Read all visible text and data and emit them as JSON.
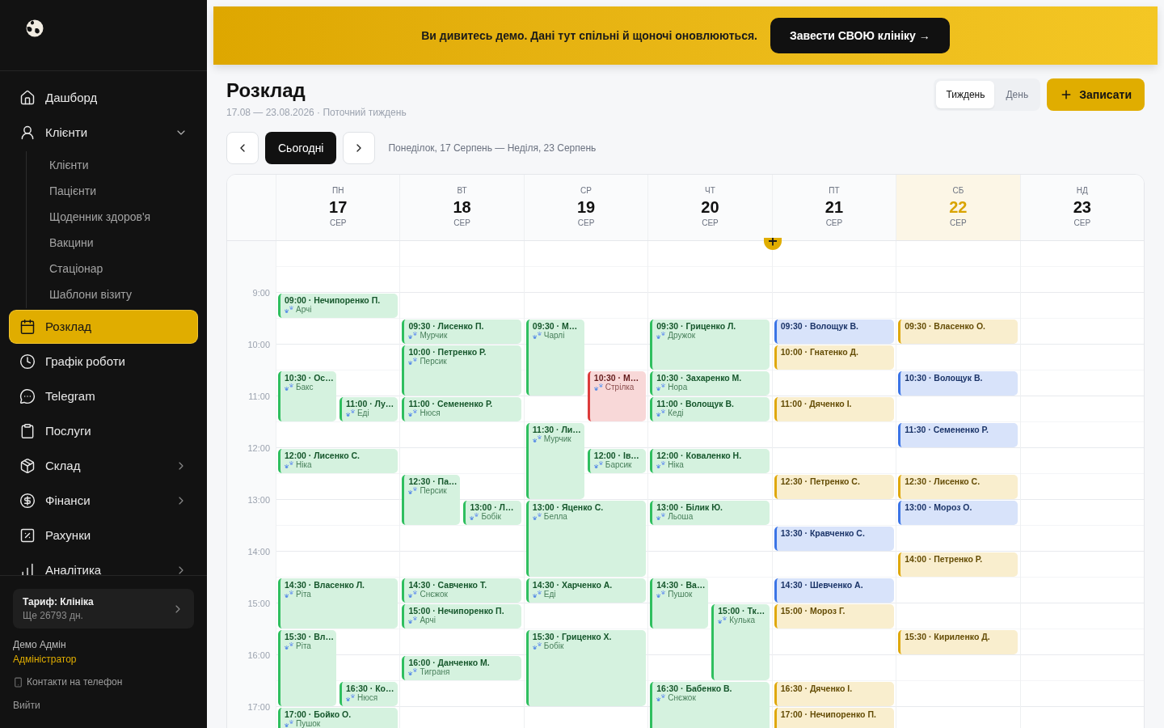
{
  "sidebar": {
    "nav": [
      {
        "label": "Дашборд",
        "selected": false
      },
      {
        "label": "Клієнти",
        "selected": false,
        "expanded": true,
        "children": [
          {
            "label": "Клієнти",
            "selected": false
          },
          {
            "label": "Пацієнти",
            "selected": false
          },
          {
            "label": "Щоденник здоров'я",
            "selected": false
          },
          {
            "label": "Вакцини",
            "selected": false
          },
          {
            "label": "Стаціонар",
            "selected": false
          },
          {
            "label": "Шаблони візиту",
            "selected": false
          }
        ]
      },
      {
        "label": "Розклад",
        "selected": true
      },
      {
        "label": "Графік роботи",
        "selected": false
      },
      {
        "label": "Telegram",
        "selected": false
      },
      {
        "label": "Послуги",
        "selected": false
      },
      {
        "label": "Склад",
        "selected": false,
        "expanded": false
      },
      {
        "label": "Фінанси",
        "selected": false,
        "expanded": false
      },
      {
        "label": "Рахунки",
        "selected": false
      },
      {
        "label": "Аналітика",
        "selected": false,
        "expanded": false
      }
    ],
    "plan": {
      "title": "Тариф: Клініка",
      "subtitle": "Ще 26793 дн."
    },
    "user": {
      "name": "Демо Адмін",
      "role": "Адміністратор"
    },
    "links": [
      {
        "label": "Контакти на телефон",
        "kind": "phone"
      },
      {
        "label": "Вийти",
        "kind": "plain"
      }
    ]
  },
  "banner": {
    "text": "Ви дивитесь демо. Дані тут спільні й щоночі оновлюються.",
    "button": "Завести СВОЮ клініку →"
  },
  "header": {
    "title": "Розклад",
    "subtitle": "17.08 — 23.08.2026 · Поточний тиждень",
    "views": [
      {
        "label": "Тиждень",
        "selected": true
      },
      {
        "label": "День",
        "selected": false
      }
    ],
    "add_button": "Записати"
  },
  "toolbar": {
    "today_button": "Сьогодні",
    "range": "Понеділок, 17 Серпень — Неділя, 23 Серпень"
  },
  "calendar": {
    "time_labels": [
      "9:00",
      "10:00",
      "11:00",
      "12:00",
      "13:00",
      "14:00",
      "15:00",
      "16:00",
      "17:00"
    ],
    "days": [
      {
        "weekday": "ПН",
        "date": "17",
        "month": "СЕР",
        "today": false,
        "events": [
          {
            "title": "09:00 · Нечипоренко П.",
            "pet": "Арчі",
            "kind": "short",
            "color": "#2fbf5f"
          },
          {
            "title": "10:30 · Ос…",
            "pet": "Бакс",
            "kind": "medium",
            "color": "#2fbf5f"
          },
          {
            "title": "11:00 · Лу…",
            "pet": "Еді",
            "kind": "short",
            "color": "#2fbf5f"
          },
          {
            "title": "12:00 · Лисенко С.",
            "pet": "Ніка",
            "kind": "short",
            "color": "#2fbf5f"
          },
          {
            "title": "14:30 · Власенко Л.",
            "pet": "Ріта",
            "kind": "medium",
            "color": "#2fbf5f"
          },
          {
            "title": "15:30 · Вл…",
            "pet": "Ріта",
            "kind": "long",
            "color": "#2fbf5f"
          },
          {
            "title": "16:30 · Ко…",
            "pet": "Нюся",
            "kind": "short",
            "color": "#2fbf5f"
          },
          {
            "title": "17:00 · Бойко О.",
            "pet": "Пушок",
            "kind": "short",
            "color": "#2fbf5f"
          }
        ]
      },
      {
        "weekday": "ВТ",
        "date": "18",
        "month": "СЕР",
        "today": false,
        "events": [
          {
            "title": "09:30 · Лисенко П.",
            "pet": "Мурчик",
            "kind": "short",
            "color": "#2fbf5f"
          },
          {
            "title": "10:00 · Петренко Р.",
            "pet": "Персик",
            "kind": "medium",
            "color": "#2fbf5f"
          },
          {
            "title": "11:00 · Семененко Р.",
            "pet": "Нюся",
            "kind": "short",
            "color": "#2fbf5f"
          },
          {
            "title": "12:30 · Па…",
            "pet": "Персик",
            "kind": "medium",
            "color": "#2fbf5f"
          },
          {
            "title": "13:00 · Л…",
            "pet": "Бобік",
            "kind": "short",
            "color": "#2fbf5f"
          },
          {
            "title": "14:30 · Савченко Т.",
            "pet": "Снєжок",
            "kind": "short",
            "color": "#2fbf5f"
          },
          {
            "title": "15:00 · Нечипоренко П.",
            "pet": "Арчі",
            "kind": "short",
            "color": "#2fbf5f"
          },
          {
            "title": "16:00 · Данченко М.",
            "pet": "Тиграня",
            "kind": "short",
            "color": "#2fbf5f"
          }
        ]
      },
      {
        "weekday": "СР",
        "date": "19",
        "month": "СЕР",
        "today": false,
        "events": [
          {
            "title": "09:30 · М…",
            "pet": "Чарлі",
            "kind": "long",
            "color": "#2fbf5f"
          },
          {
            "title": "10:30 · М…",
            "pet": "Стрілка",
            "kind": "medium",
            "color": "#dc3b3b"
          },
          {
            "title": "11:30 · Ли…",
            "pet": "Мурчик",
            "kind": "long",
            "color": "#2fbf5f"
          },
          {
            "title": "12:00 · Ів…",
            "pet": "Барсик",
            "kind": "short",
            "color": "#2fbf5f"
          },
          {
            "title": "13:00 · Яценко С.",
            "pet": "Белла",
            "kind": "long",
            "color": "#2fbf5f"
          },
          {
            "title": "14:30 · Харченко А.",
            "pet": "Еді",
            "kind": "short",
            "color": "#2fbf5f"
          },
          {
            "title": "15:30 · Гриценко Х.",
            "pet": "Бобік",
            "kind": "long",
            "color": "#2fbf5f"
          }
        ]
      },
      {
        "weekday": "ЧТ",
        "date": "20",
        "month": "СЕР",
        "today": false,
        "events": [
          {
            "title": "09:30 · Гриценко Л.",
            "pet": "Дружок",
            "kind": "medium",
            "color": "#2fbf5f"
          },
          {
            "title": "10:30 · Захаренко М.",
            "pet": "Нора",
            "kind": "short",
            "color": "#2fbf5f"
          },
          {
            "title": "11:00 · Волощук В.",
            "pet": "Кеді",
            "kind": "short",
            "color": "#2fbf5f"
          },
          {
            "title": "12:00 · Коваленко Н.",
            "pet": "Ніка",
            "kind": "short",
            "color": "#2fbf5f"
          },
          {
            "title": "13:00 · Білик Ю.",
            "pet": "Льоша",
            "kind": "short",
            "color": "#2fbf5f"
          },
          {
            "title": "14:30 · Ва…",
            "pet": "Пушок",
            "kind": "medium",
            "color": "#2fbf5f"
          },
          {
            "title": "15:00 · Тк…",
            "pet": "Кулька",
            "kind": "long",
            "color": "#2fbf5f"
          },
          {
            "title": "16:30 · Бабенко В.",
            "pet": "Снєжок",
            "kind": "medium",
            "color": "#2fbf5f"
          }
        ]
      },
      {
        "weekday": "ПТ",
        "date": "21",
        "month": "СЕР",
        "today": false,
        "events": [
          {
            "title": "09:30 · Волощук В.",
            "kind": "short",
            "color": "#3b74e6"
          },
          {
            "title": "10:00 · Гнатенко Д.",
            "kind": "short",
            "color": "#dfa80c"
          },
          {
            "title": "11:00 · Дяченко І.",
            "kind": "short",
            "color": "#dfa80c"
          },
          {
            "title": "12:30 · Петренко С.",
            "kind": "short",
            "color": "#dfa80c"
          },
          {
            "title": "13:30 · Кравченко С.",
            "kind": "short",
            "color": "#3b74e6"
          },
          {
            "title": "14:30 · Шевченко А.",
            "kind": "short",
            "color": "#3b74e6"
          },
          {
            "title": "15:00 · Мороз Г.",
            "kind": "short",
            "color": "#dfa80c"
          },
          {
            "title": "16:30 · Дяченко І.",
            "kind": "short",
            "color": "#dfa80c"
          },
          {
            "title": "17:00 · Нечипоренко П.",
            "kind": "short",
            "color": "#dfa80c"
          }
        ]
      },
      {
        "weekday": "СБ",
        "date": "22",
        "month": "СЕР",
        "today": true,
        "events": [
          {
            "title": "09:30 · Власенко О.",
            "kind": "short",
            "color": "#dfa80c"
          },
          {
            "title": "10:30 · Волощук В.",
            "kind": "short",
            "color": "#3b74e6"
          },
          {
            "title": "11:30 · Семененко Р.",
            "kind": "short",
            "color": "#3b74e6"
          },
          {
            "title": "12:30 · Лисенко С.",
            "kind": "short",
            "color": "#dfa80c"
          },
          {
            "title": "13:00 · Мороз О.",
            "kind": "short",
            "color": "#3b74e6"
          },
          {
            "title": "14:00 · Петренко Р.",
            "kind": "short",
            "color": "#dfa80c"
          },
          {
            "title": "15:30 · Кириленко Д.",
            "kind": "short",
            "color": "#dfa80c"
          }
        ]
      },
      {
        "weekday": "НД",
        "date": "23",
        "month": "СЕР",
        "today": false
      }
    ]
  }
}
